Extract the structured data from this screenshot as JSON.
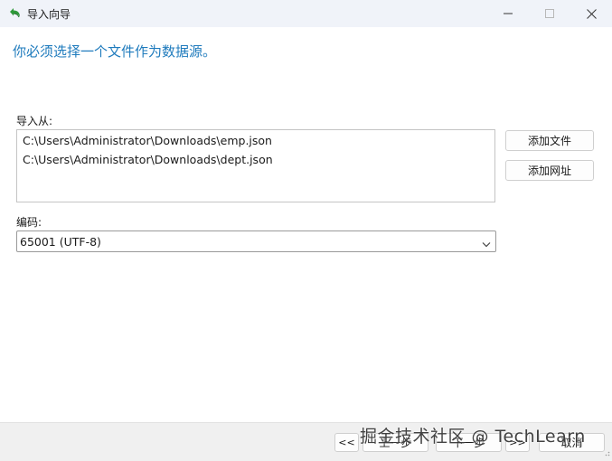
{
  "window": {
    "title": "导入向导"
  },
  "heading": "你必须选择一个文件作为数据源。",
  "import_from": {
    "label": "导入从:",
    "files": [
      "C:\\Users\\Administrator\\Downloads\\emp.json",
      "C:\\Users\\Administrator\\Downloads\\dept.json"
    ],
    "add_file_label": "添加文件",
    "add_url_label": "添加网址"
  },
  "encoding": {
    "label": "编码:",
    "selected": "65001 (UTF-8)"
  },
  "footer": {
    "first_label": "<<",
    "prev_label": "上一步",
    "next_label": "下一步",
    "last_label": ">>",
    "cancel_label": "取消"
  },
  "watermark": "掘金技术社区 @ TechLearn",
  "colors": {
    "heading": "#1f7bbd",
    "titlebar_bg": "#f0f3f9",
    "footer_bg": "#f0f0f0",
    "app_icon": "#2e9a3a"
  },
  "icons": {
    "app": "green-undo-arrow-icon",
    "minimize": "minimize-icon",
    "maximize": "maximize-icon",
    "close": "close-icon",
    "dropdown": "chevron-down-icon",
    "resize": "resize-grip-icon"
  }
}
